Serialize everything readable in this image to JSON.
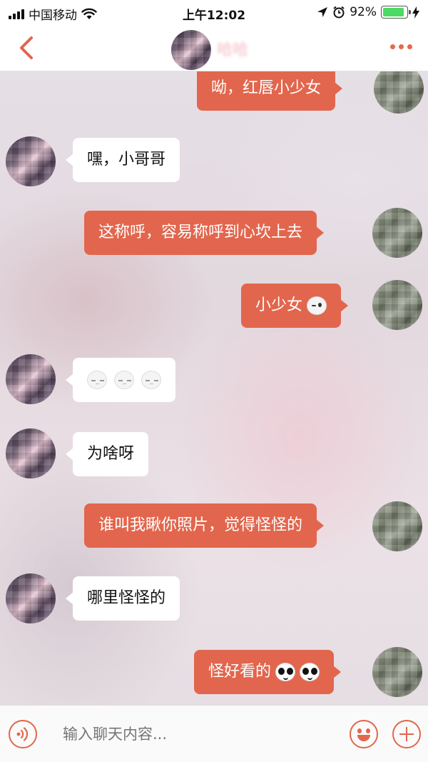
{
  "status_bar": {
    "carrier": "中国移动",
    "time": "上午12:02",
    "battery_percent": "92%",
    "battery_level": 0.92
  },
  "header": {
    "contact_name": "哈哈",
    "back_icon": "chevron-left-icon",
    "more_icon": "more-dots-icon"
  },
  "messages": [
    {
      "side": "self",
      "text": "呦，红唇小少女"
    },
    {
      "side": "other",
      "text": "嘿，小哥哥"
    },
    {
      "side": "self",
      "text": "这称呼，容易称呼到心坎上去"
    },
    {
      "side": "self",
      "text": "小少女",
      "emoji": [
        "wink-emoji"
      ]
    },
    {
      "side": "other",
      "text": "",
      "emoji": [
        "sleepy-emoji",
        "sleepy-emoji",
        "sleepy-emoji"
      ]
    },
    {
      "side": "other",
      "text": "为啥呀"
    },
    {
      "side": "self",
      "text": "谁叫我瞅你照片，觉得怪怪的"
    },
    {
      "side": "other",
      "text": "哪里怪怪的"
    },
    {
      "side": "self",
      "text": "怪好看的",
      "emoji": [
        "eyes-emoji",
        "eyes-emoji"
      ]
    }
  ],
  "input_bar": {
    "placeholder": "输入聊天内容...",
    "voice_icon": "voice-icon",
    "emoji_icon": "smiley-icon",
    "plus_icon": "plus-icon"
  },
  "colors": {
    "accent": "#e2664d",
    "self_bubble": "#e2664d",
    "other_bubble": "#ffffff"
  }
}
